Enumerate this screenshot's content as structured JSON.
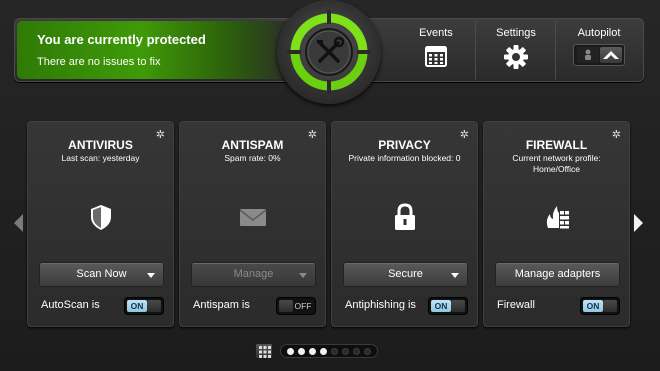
{
  "header": {
    "status_title": "You are currently protected",
    "status_subtitle": "There are no issues to fix",
    "events_label": "Events",
    "settings_label": "Settings",
    "autopilot_label": "Autopilot"
  },
  "modules": [
    {
      "title": "ANTIVIRUS",
      "subtitle": "Last scan: yesterday",
      "action": "Scan Now",
      "toggle_label": "AutoScan is",
      "toggle_state": "ON",
      "icon": "shield-icon"
    },
    {
      "title": "ANTISPAM",
      "subtitle": "Spam rate: 0%",
      "action": "Manage",
      "toggle_label": "Antispam is",
      "toggle_state": "OFF",
      "icon": "envelope-icon"
    },
    {
      "title": "PRIVACY",
      "subtitle": "Private information blocked: 0",
      "action": "Secure",
      "toggle_label": "Antiphishing is",
      "toggle_state": "ON",
      "icon": "padlock-icon"
    },
    {
      "title": "FIREWALL",
      "subtitle": "Current network profile: Home/Office",
      "action": "Manage adapters",
      "toggle_label": "Firewall",
      "toggle_state": "ON",
      "icon": "firewall-icon"
    }
  ],
  "pager": {
    "total": 8,
    "active": 4
  },
  "colors": {
    "accent_green": "#3f9a08",
    "toggle_on": "#9fd0ec"
  }
}
